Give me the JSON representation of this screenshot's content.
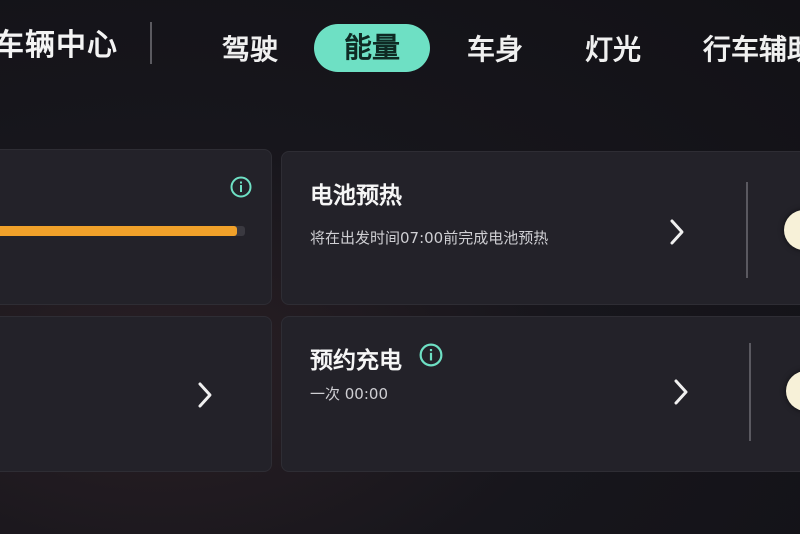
{
  "header": {
    "title": "车辆中心",
    "tabs": [
      {
        "label": "驾驶",
        "active": false
      },
      {
        "label": "能量",
        "active": true
      },
      {
        "label": "车身",
        "active": false
      },
      {
        "label": "灯光",
        "active": false
      },
      {
        "label": "行车辅助",
        "active": false
      }
    ]
  },
  "colors": {
    "accent": "#6ee0c4",
    "progress": "#f0a12a",
    "card_bg": "#232229"
  },
  "left_panel": {
    "top_card": {
      "info_icon": "info-icon",
      "progress_fraction": 0.97
    },
    "bottom_card": {
      "chevron_icon": "chevron-right-icon"
    }
  },
  "right_panel": {
    "battery_preheat": {
      "title": "电池预热",
      "subtitle": "将在出发时间07:00前完成电池预热",
      "chevron_icon": "chevron-right-icon",
      "toggle": true
    },
    "scheduled_charging": {
      "title": "预约充电",
      "info_icon": "info-icon",
      "subtitle": "一次 00:00",
      "chevron_icon": "chevron-right-icon",
      "toggle": true
    }
  }
}
